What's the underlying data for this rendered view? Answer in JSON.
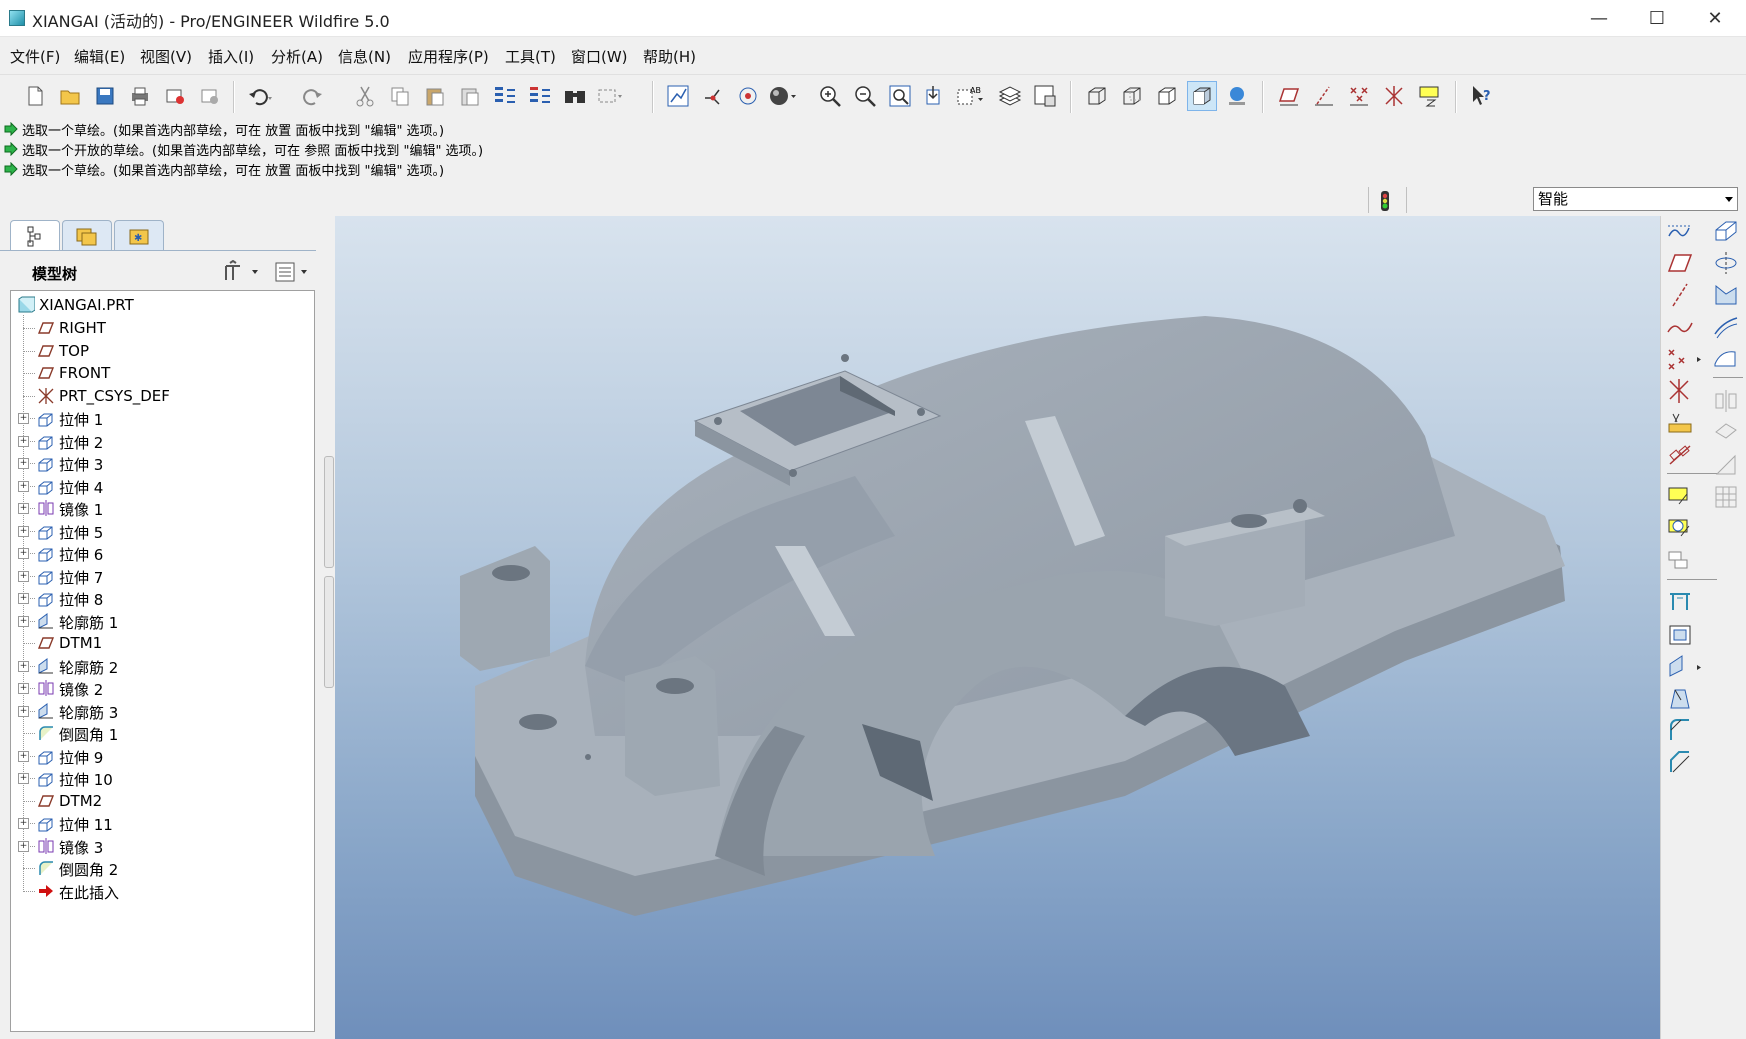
{
  "window": {
    "title": "XIANGAI (活动的) - Pro/ENGINEER Wildfire 5.0",
    "controls": [
      "—",
      "☐",
      "✕"
    ]
  },
  "menubar": {
    "items": [
      "文件(F)",
      "编辑(E)",
      "视图(V)",
      "插入(I)",
      "分析(A)",
      "信息(N)",
      "应用程序(P)",
      "工具(T)",
      "窗口(W)",
      "帮助(H)"
    ]
  },
  "messages": [
    "选取一个草绘。(如果首选内部草绘，可在 放置 面板中找到 \"编辑\" 选项。)",
    "选取一个开放的草绘。(如果首选内部草绘，可在 参照 面板中找到 \"编辑\" 选项。)",
    "选取一个草绘。(如果首选内部草绘，可在 放置 面板中找到 \"编辑\" 选项。)"
  ],
  "filter": {
    "selected": "智能"
  },
  "model_tree": {
    "title": "模型树",
    "root": "XIANGAI.PRT",
    "items": [
      {
        "label": "RIGHT",
        "icon": "datum-plane-icon",
        "expandable": false
      },
      {
        "label": "TOP",
        "icon": "datum-plane-icon",
        "expandable": false
      },
      {
        "label": "FRONT",
        "icon": "datum-plane-icon",
        "expandable": false
      },
      {
        "label": "PRT_CSYS_DEF",
        "icon": "csys-icon",
        "expandable": false
      },
      {
        "label": "拉伸 1",
        "icon": "extrude-icon",
        "expandable": true
      },
      {
        "label": "拉伸 2",
        "icon": "extrude-icon",
        "expandable": true
      },
      {
        "label": "拉伸 3",
        "icon": "extrude-icon",
        "expandable": true
      },
      {
        "label": "拉伸 4",
        "icon": "extrude-icon",
        "expandable": true
      },
      {
        "label": "镜像 1",
        "icon": "mirror-icon",
        "expandable": true
      },
      {
        "label": "拉伸 5",
        "icon": "extrude-icon",
        "expandable": true
      },
      {
        "label": "拉伸 6",
        "icon": "extrude-icon",
        "expandable": true
      },
      {
        "label": "拉伸 7",
        "icon": "extrude-icon",
        "expandable": true
      },
      {
        "label": "拉伸 8",
        "icon": "extrude-icon",
        "expandable": true
      },
      {
        "label": "轮廓筋 1",
        "icon": "rib-icon",
        "expandable": true
      },
      {
        "label": "DTM1",
        "icon": "datum-plane-icon",
        "expandable": false
      },
      {
        "label": "轮廓筋 2",
        "icon": "rib-icon",
        "expandable": true
      },
      {
        "label": "镜像 2",
        "icon": "mirror-icon",
        "expandable": true
      },
      {
        "label": "轮廓筋 3",
        "icon": "rib-icon",
        "expandable": true
      },
      {
        "label": "倒圆角 1",
        "icon": "round-icon",
        "expandable": false
      },
      {
        "label": "拉伸 9",
        "icon": "extrude-icon",
        "expandable": true
      },
      {
        "label": "拉伸 10",
        "icon": "extrude-icon",
        "expandable": true
      },
      {
        "label": "DTM2",
        "icon": "datum-plane-icon",
        "expandable": false
      },
      {
        "label": "拉伸 11",
        "icon": "extrude-icon",
        "expandable": true
      },
      {
        "label": "镜像 3",
        "icon": "mirror-icon",
        "expandable": true
      },
      {
        "label": "倒圆角 2",
        "icon": "round-icon",
        "expandable": false
      },
      {
        "label": "在此插入",
        "icon": "insert-here-icon",
        "expandable": false
      }
    ]
  },
  "colors": {
    "viewport_top": "#d8e3ee",
    "viewport_bottom": "#6f8fbb",
    "model_gray": "#a5aeb8"
  }
}
